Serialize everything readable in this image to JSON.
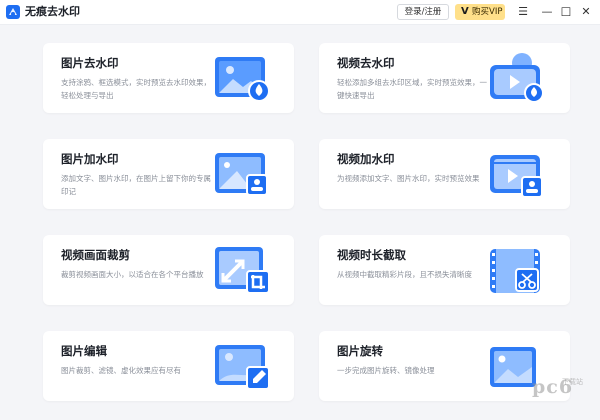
{
  "app": {
    "title": "无痕去水印",
    "login_label": "登录/注册",
    "vip_mark": "V",
    "vip_label": "购买VIP",
    "menu_glyph": "☰",
    "minimize_glyph": "—",
    "maximize_glyph": "☐",
    "close_glyph": "✕"
  },
  "cards": [
    {
      "title": "图片去水印",
      "desc": "支持涂鸦、框选模式，实时预览去水印效果，轻松处理与导出"
    },
    {
      "title": "视频去水印",
      "desc": "轻松添加多组去水印区域，实时预览效果，一键快速导出"
    },
    {
      "title": "图片加水印",
      "desc": "添加文字、图片水印，在图片上留下你的专属印记"
    },
    {
      "title": "视频加水印",
      "desc": "为视频添加文字、图片水印，实时预览效果"
    },
    {
      "title": "视频画面裁剪",
      "desc": "裁剪视频画面大小，以适合在各个平台播放"
    },
    {
      "title": "视频时长截取",
      "desc": "从视频中截取精彩片段，且不损失清晰度"
    },
    {
      "title": "图片编辑",
      "desc": "图片裁剪、滤镜、虚化效果应有尽有"
    },
    {
      "title": "图片旋转",
      "desc": "一步完成图片旋转、镜像处理"
    }
  ],
  "watermark": {
    "text": "pc6",
    "sub": "下载站"
  },
  "colors": {
    "accent": "#1e6ef2",
    "illustration_light": "#cfe2ff",
    "vip_bg": "#ffe08a"
  }
}
